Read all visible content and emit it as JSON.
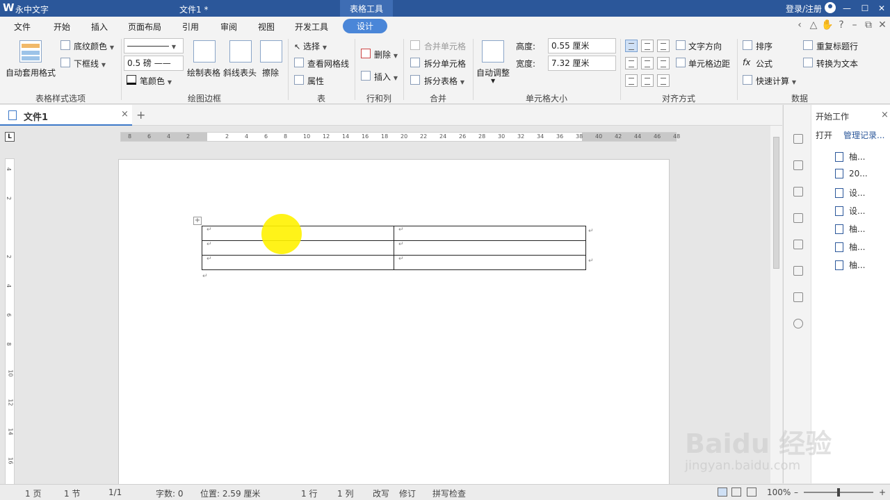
{
  "titlebar": {
    "app": "永中文字",
    "doc": "文件1 *",
    "context_tab": "表格工具",
    "login": "登录/注册",
    "minimize": "—",
    "maximize": "☐",
    "close": "✕"
  },
  "menu": {
    "items": [
      "文件",
      "开始",
      "插入",
      "页面布局",
      "引用",
      "审阅",
      "视图",
      "开发工具",
      "设计"
    ],
    "right_tools": [
      "‹",
      "△",
      "✋",
      "?",
      "–",
      "⧉",
      "✕"
    ]
  },
  "ribbon": {
    "style_options": {
      "auto_format": "自动套用格式",
      "shading": "底纹颜色",
      "underline": "下框线",
      "group": "表格样式选项"
    },
    "draw_border": {
      "line_weight": "0.5",
      "unit": "磅",
      "pen_color": "笔颜色",
      "draw_table": "绘制表格",
      "diagonal_header": "斜线表头",
      "erase": "擦除",
      "group": "绘图边框"
    },
    "table": {
      "select": "选择",
      "gridlines": "查看网格线",
      "properties": "属性",
      "group": "表"
    },
    "rows_cols": {
      "delete": "删除",
      "insert": "插入",
      "group": "行和列"
    },
    "merge": {
      "merge_cells": "合并单元格",
      "split_cells": "拆分单元格",
      "split_table": "拆分表格",
      "group": "合并"
    },
    "cell_size": {
      "auto_fit": "自动调整",
      "height_label": "高度:",
      "height_value": "0.55 厘米",
      "width_label": "宽度:",
      "width_value": "7.32 厘米",
      "group": "单元格大小"
    },
    "alignment": {
      "text_direction": "文字方向",
      "cell_margins": "单元格边距",
      "group": "对齐方式"
    },
    "data": {
      "sort": "排序",
      "formula": "公式",
      "quick_calc": "快速计算",
      "repeat_header": "重复标题行",
      "to_text": "转换为文本",
      "group": "数据"
    }
  },
  "tabs": {
    "doc_tab": "文件1",
    "close": "×",
    "add": "+"
  },
  "ruler": {
    "corner": "L",
    "ticks": [
      "8",
      "6",
      "4",
      "2",
      "",
      "2",
      "4",
      "6",
      "8",
      "10",
      "12",
      "14",
      "16",
      "18",
      "20",
      "22",
      "24",
      "26",
      "28",
      "30",
      "32",
      "34",
      "36",
      "38",
      "40",
      "42",
      "44",
      "46",
      "48"
    ],
    "vticks": [
      "4",
      "2",
      "",
      "2",
      "4",
      "6",
      "8",
      "10",
      "12",
      "14",
      "16"
    ]
  },
  "document": {
    "para_mark": "↵"
  },
  "sidepanel": {
    "title": "开始工作",
    "close": "×",
    "open": "打开",
    "manage": "管理记录...",
    "recent": [
      "柚...",
      "20...",
      "设...",
      "设...",
      "柚...",
      "柚...",
      "柚..."
    ]
  },
  "status": {
    "page": "1 页",
    "section": "1 节",
    "page_of": "1/1",
    "word_count": "字数: 0",
    "position": "位置: 2.59 厘米",
    "line": "1 行",
    "col": "1 列",
    "overwrite": "改写",
    "revise": "修订",
    "spell": "拼写检查",
    "zoom": "100%",
    "zoom_minus": "–",
    "zoom_plus": "+",
    "zoom_level": 0.5
  },
  "watermark": {
    "big": "Baidu 经验",
    "small": "jingyan.baidu.com"
  }
}
